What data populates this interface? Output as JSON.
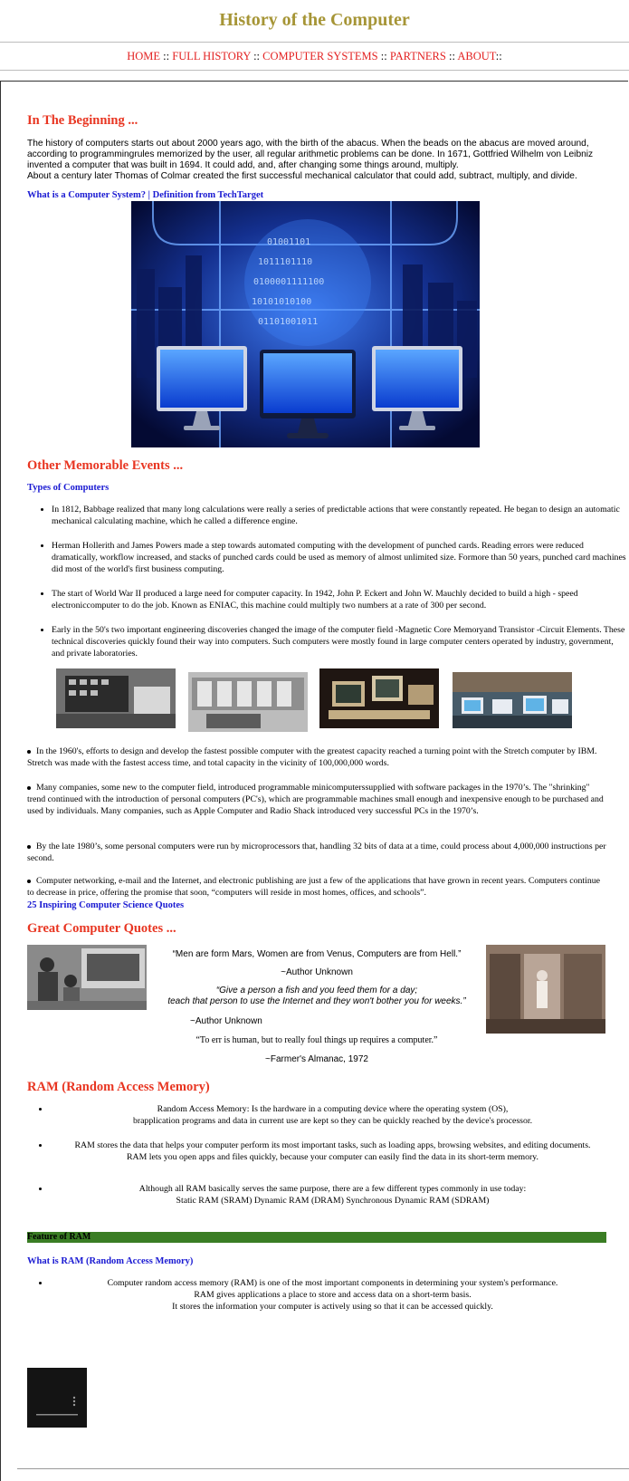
{
  "header": {
    "site_title": "History of the Computer",
    "nav": [
      {
        "label": "HOME"
      },
      {
        "label": "FULL HISTORY"
      },
      {
        "label": "COMPUTER SYSTEMS"
      },
      {
        "label": "PARTNERS"
      },
      {
        "label": "ABOUT"
      }
    ],
    "nav_separator": "::"
  },
  "section1": {
    "heading": "In The Beginning ...",
    "paragraph_1": "The history of computers starts out about 2000 years ago, with the birth of the abacus. When the beads on the abacus are moved around, according to programmingrules memorized by the user, all regular arithmetic problems can be done. In 1671, Gottfried Wilhelm von Leibniz invented a computer that was built in 1694. It could add, and, after changing some things around, multiply.",
    "paragraph_2": "About a century later Thomas of Colmar created the first successful mechanical calculator that could add, subtract, multiply, and divide.",
    "link": "What is a Computer System? | Definition from TechTarget"
  },
  "section2": {
    "heading": "Other Memorable Events ...",
    "link": "Types of Computers",
    "events": [
      "In 1812, Babbage realized that many long calculations were really a series of predictable actions that were constantly repeated. He began to design an automatic mechanical calculating machine, which he called a difference engine.",
      "Herman Hollerith and James Powers made a step towards automated computing with the development of punched cards. Reading errors were reduced dramatically, workflow increased, and stacks of punched cards could be used as memory of almost unlimited size. Formore than 50 years, punched card machines did most of the world's first business computing.",
      "The start of World War II produced a large need for computer capacity. In 1942, John P. Eckert and John W. Mauchly decided to build a high - speed electroniccomputer to do the job. Known as ENIAC, this machine could multiply two numbers at a rate of 300 per second.",
      "Early in the 50's two important engineering discoveries changed the image of the computer field -Magnetic Core Memoryand Transistor -Circuit Elements. These technical discoveries quickly found their way into computers. Such computers were mostly found in large computer centers operated by industry, government, and private laboratories."
    ],
    "later_events": [
      "In the 1960's, efforts to design and develop the fastest possible computer with the greatest capacity reached a turning point with the Stretch computer by IBM. Stretch was made with the fastest access time, and total capacity in the vicinity of 100,000,000 words.",
      "Many companies, some new to the computer field, introduced programmable minicomputerssupplied with software packages in the 1970’s. The \"shrinking\" trend continued with the introduction of personal computers (PC's), which are programmable machines small enough and inexpensive enough to be purchased and used by individuals. Many companies, such as Apple Computer and Radio Shack introduced very successful PCs in the 1970’s.",
      "By the late 1980’s, some personal computers were run by microprocessors that, handling 32 bits of data at a time, could process about 4,000,000 instructions per second.",
      "Computer networking, e-mail and the Internet, and electronic publishing are just a few of the applications that have grown in recent years. Computers continue to decrease in price, offering the promise that soon, “computers will reside in most homes, offices, and schools”."
    ],
    "quotes_link": "25 Inspiring Computer Science Quotes"
  },
  "quotes": {
    "heading": "Great Computer Quotes ...",
    "q1": "“Men are form Mars, Women are from Venus, Computers are from Hell.”",
    "a1": "~Author Unknown",
    "q2_line1": "“Give a person a fish and you feed them for a day;",
    "q2_line2": "teach that person to use the Internet and they won't bother you for weeks.”",
    "a2": "~Author Unknown",
    "q3": "“To err is human, but to really foul things up requires a computer.”",
    "a3": "~Farmer's Almanac, 1972"
  },
  "ram": {
    "heading": "RAM (Random Access Memory)",
    "item1_line1": "Random Access Memory: Is the hardware in a computing device where the operating system (OS),",
    "item1_line2": "brapplication programs and data in current use are kept so they can be quickly reached by the device's processor.",
    "item2_line1": "RAM stores the data that helps your computer perform its most important tasks, such as loading apps, browsing websites, and editing documents.",
    "item2_line2": "RAM lets you open apps and files quickly, because your computer can easily find the data in its short-term memory.",
    "item3_line1": "Although all RAM basically serves the same purpose, there are a few different types commonly in use today:",
    "item3_line2": "Static RAM (SRAM) Dynamic RAM (DRAM) Synchronous Dynamic RAM (SDRAM)",
    "feature_bar": "Feature of RAM",
    "link": "What is RAM (Random Access Memory)",
    "item4_line1": "Computer random access memory (RAM) is one of the most important components in determining your system's performance.",
    "item4_line2": "RAM gives applications a place to store and access data on a short-term basis.",
    "item4_line3": "It stores the information your computer is actively using so that it can be accessed quickly."
  },
  "colors": {
    "title_gold": "#a69536",
    "nav_red": "#e32121",
    "heading_red": "#e83521",
    "link_blue": "#1919d2",
    "feature_green": "#3a7d24"
  }
}
